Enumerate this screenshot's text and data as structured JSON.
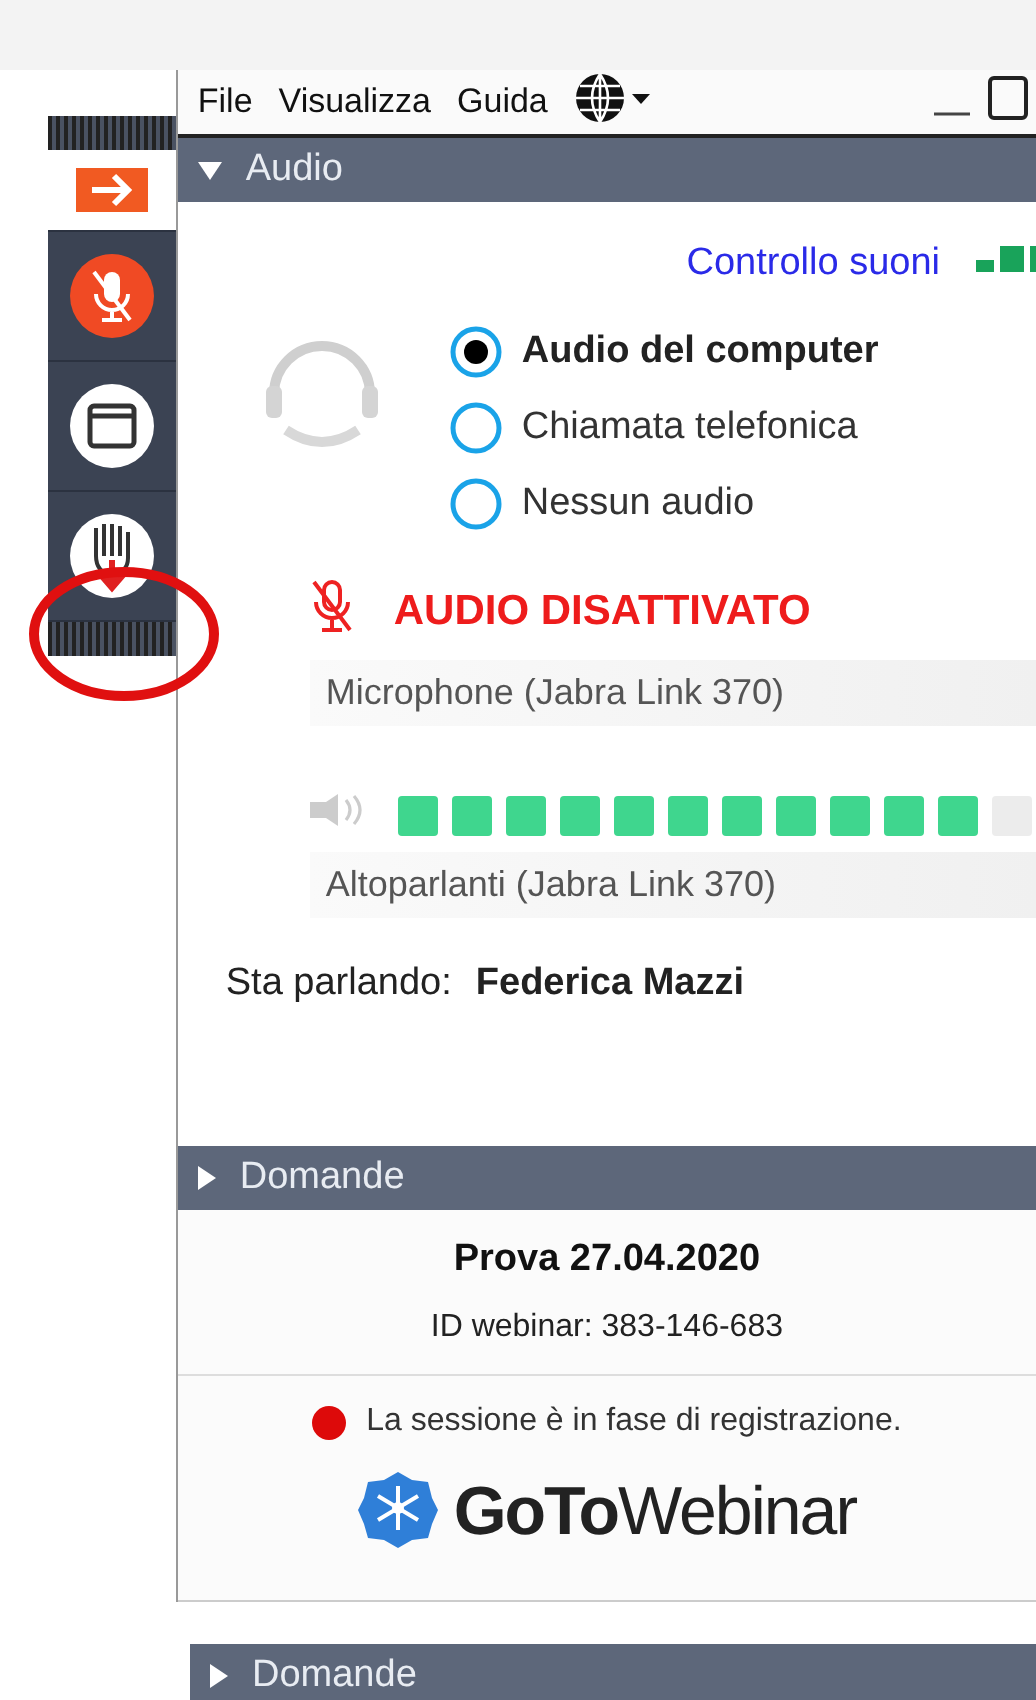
{
  "menu": [
    {
      "label": "File"
    },
    {
      "label": "Visualizza"
    },
    {
      "label": "Guida"
    }
  ],
  "toolbar": {
    "items": [
      {
        "kind": "arrow",
        "selected": true
      },
      {
        "kind": "mic_muted",
        "selected": false
      },
      {
        "kind": "window",
        "selected": false
      },
      {
        "kind": "hand",
        "selected": false
      }
    ]
  },
  "audio": {
    "title": "Audio",
    "expanded": true,
    "sound_check": "Controllo suoni",
    "options": [
      {
        "label": "Audio del computer",
        "selected": true
      },
      {
        "label": "Chiamata telefonica",
        "selected": false
      },
      {
        "label": "Nessun audio",
        "selected": false
      }
    ],
    "mute_status": "AUDIO DISATTIVATO",
    "microphone": "Microphone (Jabra Link 370)",
    "speaker_meter": {
      "level": 0.79
    },
    "speaker": "Altoparlanti (Jabra Link 370)",
    "speaking_label": "Sta parlando:",
    "speaking_name": "Federica Mazzi"
  },
  "questions": {
    "title": "Domande",
    "expanded": false
  },
  "session": {
    "title": "Prova 27.04.2020",
    "webinar_id": "ID webinar: 383-146-683",
    "recording": "La sessione è in fase di registrazione.",
    "logo": "**GoTo**Webinar"
  },
  "questions_lower": {
    "title": "Domande",
    "expanded": false
  }
}
